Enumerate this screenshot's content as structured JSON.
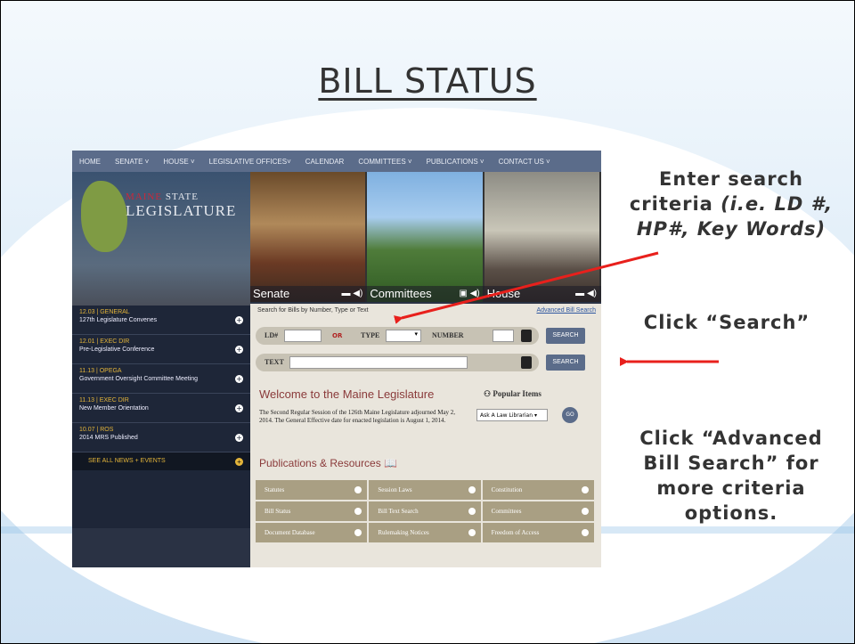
{
  "slide": {
    "title": "BILL STATUS",
    "accent_color": "#e8201c"
  },
  "nav": [
    "HOME",
    "SENATE ˅",
    "HOUSE ˅",
    "LEGISLATIVE OFFICES˅",
    "CALENDAR",
    "COMMITTEES ˅",
    "PUBLICATIONS ˅",
    "CONTACT US ˅"
  ],
  "logo": {
    "maine": "MAINE",
    "state": "STATE",
    "legislature": "LEGISLATURE"
  },
  "photos": [
    "Senate",
    "Committees",
    "House"
  ],
  "news": [
    {
      "date": "12.03 | GENERAL",
      "title": "127th Legislature Convenes"
    },
    {
      "date": "12.01 | EXEC DIR",
      "title": "Pre-Legislative Conference"
    },
    {
      "date": "11.13 | OPEGA",
      "title": "Government Oversight Committee Meeting"
    },
    {
      "date": "11.13 | EXEC DIR",
      "title": "New Member Orientation"
    },
    {
      "date": "10.07 | ROS",
      "title": "2014 MRS Published"
    }
  ],
  "see_all": "SEE ALL NEWS + EVENTS",
  "search": {
    "heading": "Search for Bills by Number, Type or Text",
    "advanced_link": "Advanced Bill Search",
    "ld_label": "LD#",
    "or_label": "OR",
    "type_label": "TYPE",
    "number_label": "NUMBER",
    "text_label": "TEXT",
    "button_label": "SEARCH"
  },
  "welcome": {
    "title": "Welcome to the Maine Legislature",
    "body": "The Second Regular Session of the 126th Maine Legislature adjourned May 2, 2014. The General Effective date for enacted legislation is August 1, 2014."
  },
  "popular": {
    "title": "Popular Items",
    "selected": "Ask A Law Librarian",
    "go": "GO"
  },
  "publications": {
    "title": "Publications & Resources",
    "items": [
      "Statutes",
      "Session Laws",
      "Constitution",
      "Bill Status",
      "Bill Text Search",
      "Committees",
      "Document Database",
      "Rulemaking Notices",
      "Freedom of Access"
    ]
  },
  "notes": {
    "n1_line1": "Enter search",
    "n1_line2": "criteria",
    "n1_italic": "(i.e. LD #, HP#, Key Words)",
    "n2": "Click “Search”",
    "n3": "Click “Advanced Bill Search” for more criteria options."
  }
}
